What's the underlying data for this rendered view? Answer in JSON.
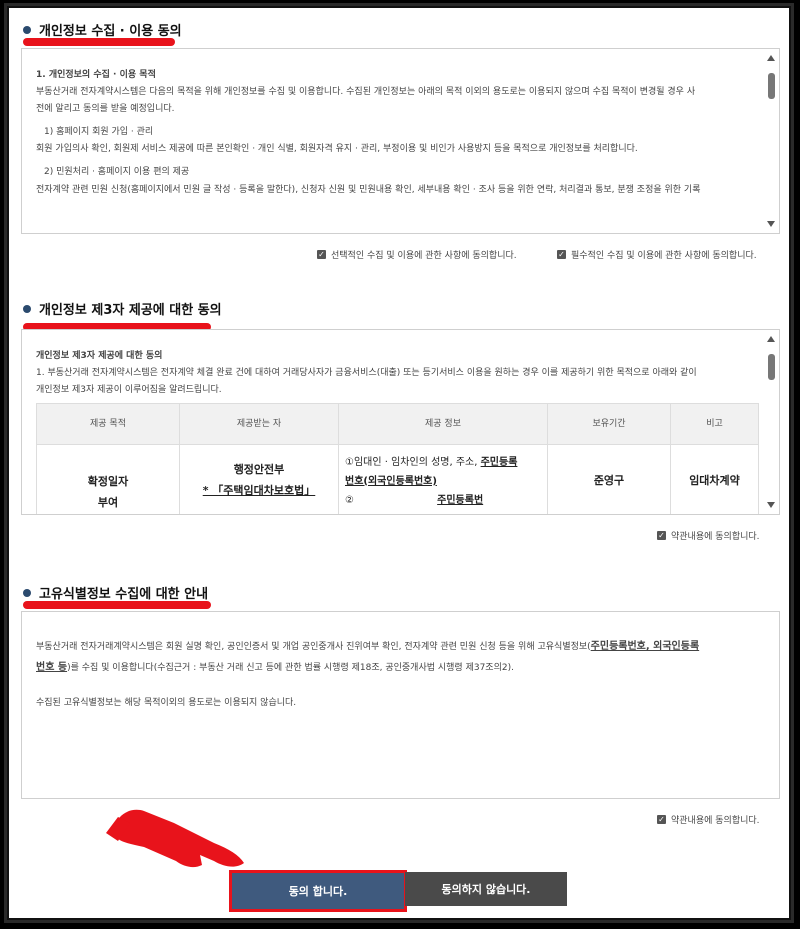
{
  "sections": {
    "personal": {
      "title": "개인정보 수집 · 이용 동의",
      "heading": "1. 개인정보의 수집 · 이용 목적",
      "para1": "부동산거래 전자계약시스템은 다음의 목적을 위해 개인정보를 수집 및 이용합니다. 수집된 개인정보는 아래의 목적 이외의 용도로는 이용되지 않으며 수집 목적이 변경될 경우 사",
      "para1b": "전에 알리고 동의를 받을 예정입니다.",
      "item1": "1) 홈페이지 회원 가입 · 관리",
      "item1_text": "회원 가입의사 확인, 회원제 서비스 제공에 따른 본인확인 · 개인 식별, 회원자격 유지 · 관리, 부정이용 및 비인가 사용방지 등을 목적으로 개인정보를 처리합니다.",
      "item2": "2) 민원처리 · 홈페이지 이용 편의 제공",
      "item2_text": "전자계약 관련 민원 신청(홈페이지에서 민원 글 작성 · 등록을 말한다), 신청자 신원 및 민원내용 확인, 세부내용 확인 · 조사 등을 위한 연락, 처리결과 통보, 분쟁 조정을 위한 기록",
      "agree_optional": "선택적인 수집 및 이용에 관한 사항에 동의합니다.",
      "agree_required": "필수적인 수집 및 이용에 관한 사항에 동의합니다."
    },
    "third": {
      "title": "개인정보 제3자 제공에 대한 동의",
      "heading": "개인정보 제3자 제공에 대한 동의",
      "para1": "1. 부동산거래 전자계약시스템은 전자계약 체결 완료 건에 대하여 거래당사자가 금융서비스(대출) 또는 등기서비스 이용을 원하는 경우 이를 제공하기 위한 목적으로 아래와 같이",
      "para1b": "개인정보 제3자 제공이 이루어짐을 알려드립니다.",
      "table_headers": [
        "제공 목적",
        "제공받는 자",
        "제공 정보",
        "보유기간",
        "비고"
      ],
      "row": {
        "purpose": "확정일자",
        "purpose2": "부여",
        "receiver": "행정안전부",
        "receiver2": "* 「주택임대차보호법」",
        "info_a": "①임대인 · 임차인의 성명, 주소, ",
        "info_b": "주민등록",
        "info_c": "번호(외국인등록번호)",
        "info_d": "② ",
        "info_e": "주민등록번",
        "period": "준영구",
        "note": "임대차계약"
      },
      "agree": "약관내용에 동의합니다."
    },
    "unique": {
      "title": "고유식별정보 수집에 대한 안내",
      "para1a": "부동산거래 전자거래계약시스템은 회원 실명 확인, 공인인증서 및 개업 공인중개사 진위여부 확인, 전자계약 관련 민원 신청 등을 위해 고유식별정보(",
      "para1u": "주민등록번호, 외국인등록",
      "para1u2": "번호 등",
      "para1b": ")를 수집 및 이용합니다(수집근거 : 부동산 거래 신고 등에 관한 법률 시행령 제18조, 공인중개사법 시행령 제37조의2).",
      "para2": "수집된 고유식별정보는 해당 목적이외의 용도로는 이용되지 않습니다.",
      "agree": "약관내용에 동의합니다."
    }
  },
  "buttons": {
    "agree": "동의 합니다.",
    "decline": "동의하지 않습니다."
  },
  "colors": {
    "highlight": "#e8131b",
    "primary": "#3f5a7e",
    "secondary": "#4a4a4a"
  }
}
